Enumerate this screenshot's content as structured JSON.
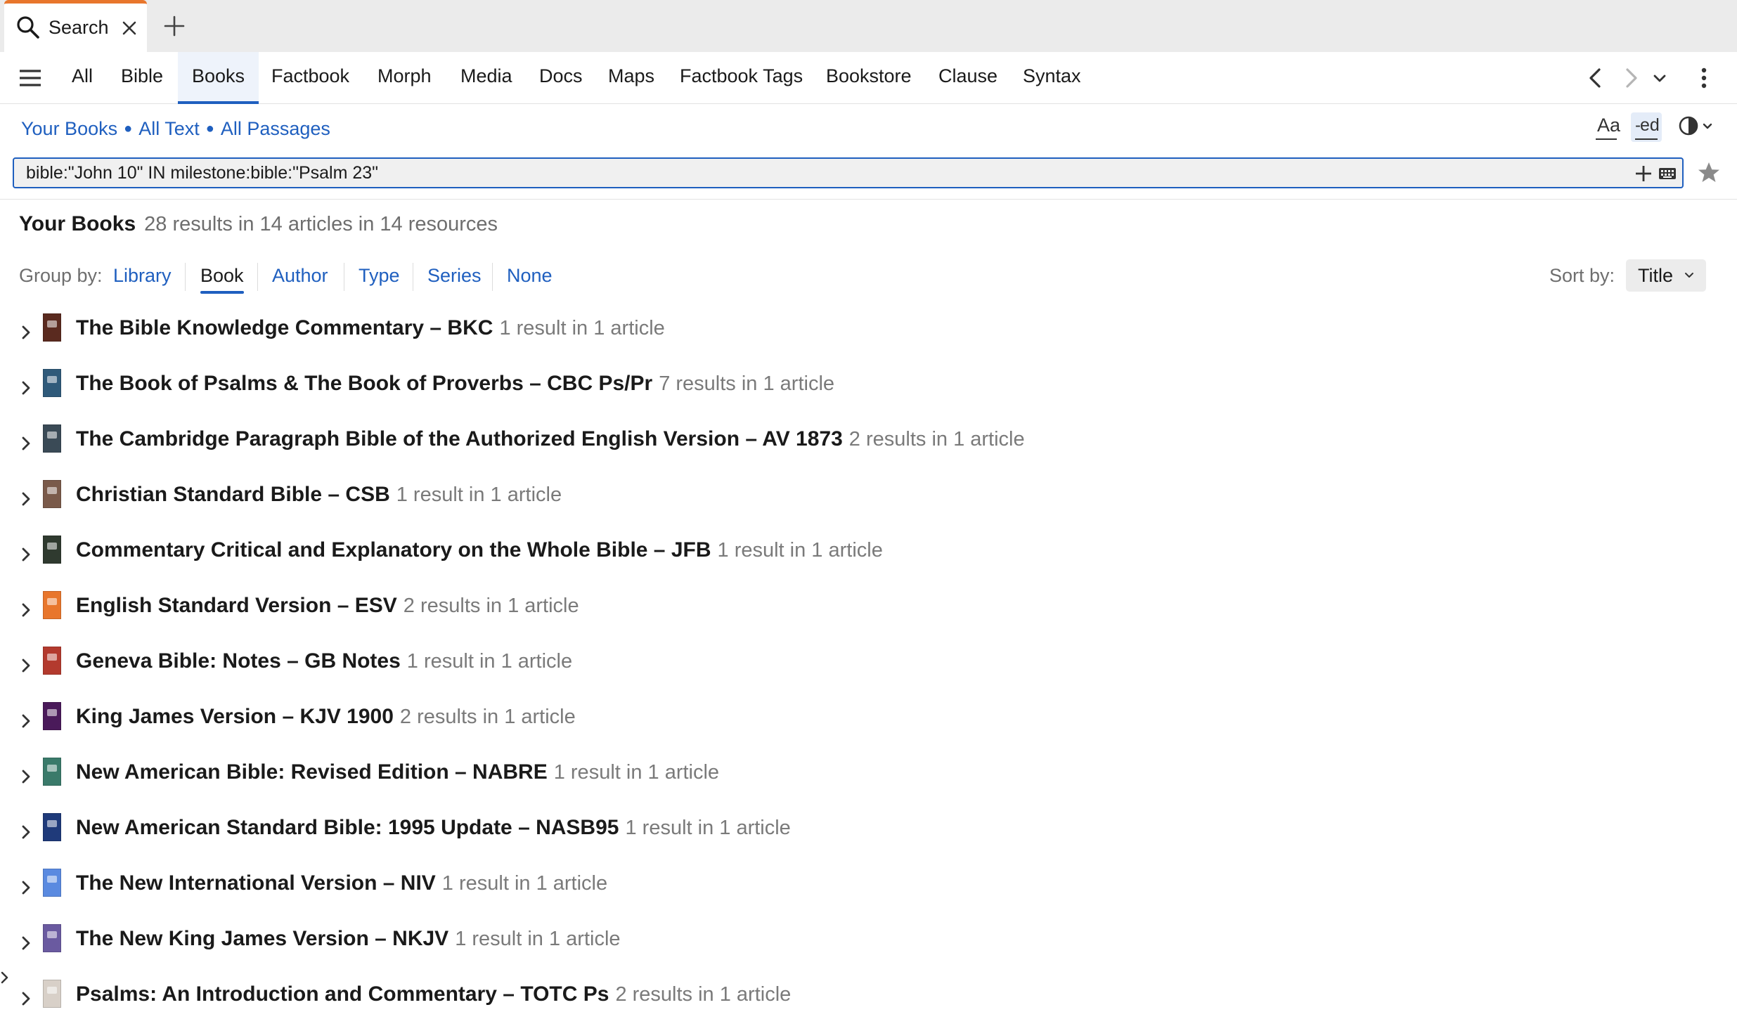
{
  "tab": {
    "title": "Search",
    "icon": "search-icon"
  },
  "nav": {
    "items": [
      "All",
      "Bible",
      "Books",
      "Factbook",
      "Morph",
      "Media",
      "Docs",
      "Maps",
      "Factbook Tags",
      "Bookstore",
      "Clause",
      "Syntax"
    ],
    "active": "Books"
  },
  "scope": {
    "books": "Your Books",
    "text": "All Text",
    "passages": "All Passages"
  },
  "toolbar": {
    "font_label": "Aa",
    "edit_label": "ed"
  },
  "query": {
    "value": "bible:\"John 10\" IN milestone:bible:\"Psalm 23\""
  },
  "summary": {
    "title": "Your Books",
    "count": "28 results in 14 articles in 14 resources"
  },
  "group_by": {
    "label": "Group by:",
    "options": [
      "Library",
      "Book",
      "Author",
      "Type",
      "Series",
      "None"
    ],
    "active": "Book"
  },
  "sort_by": {
    "label": "Sort by:",
    "value": "Title"
  },
  "results": [
    {
      "title": "The Bible Knowledge Commentary – BKC",
      "count": "1 result in 1 article",
      "cover_color": "#5a2a1f"
    },
    {
      "title": "The Book of Psalms & The Book of Proverbs – CBC Ps/Pr",
      "count": "7 results in 1 article",
      "cover_color": "#2f5a7a"
    },
    {
      "title": "The Cambridge Paragraph Bible of the Authorized English Version – AV 1873",
      "count": "2 results in 1 article",
      "cover_color": "#3a4a56"
    },
    {
      "title": "Christian Standard Bible – CSB",
      "count": "1 result in 1 article",
      "cover_color": "#7a5a4a"
    },
    {
      "title": "Commentary Critical and Explanatory on the Whole Bible – JFB",
      "count": "1 result in 1 article",
      "cover_color": "#2f3a2f"
    },
    {
      "title": "English Standard Version – ESV",
      "count": "2 results in 1 article",
      "cover_color": "#e8762c"
    },
    {
      "title": "Geneva Bible: Notes – GB Notes",
      "count": "1 result in 1 article",
      "cover_color": "#b33a2e"
    },
    {
      "title": "King James Version – KJV 1900",
      "count": "2 results in 1 article",
      "cover_color": "#4a1a5a"
    },
    {
      "title": "New American Bible: Revised Edition – NABRE",
      "count": "1 result in 1 article",
      "cover_color": "#3a7a6a"
    },
    {
      "title": "New American Standard Bible: 1995 Update – NASB95",
      "count": "1 result in 1 article",
      "cover_color": "#1f3a7a"
    },
    {
      "title": "The New International Version – NIV",
      "count": "1 result in 1 article",
      "cover_color": "#5a8ae0"
    },
    {
      "title": "The New King James Version – NKJV",
      "count": "1 result in 1 article",
      "cover_color": "#6a5aa0"
    },
    {
      "title": "Psalms: An Introduction and Commentary – TOTC Ps",
      "count": "2 results in 1 article",
      "cover_color": "#d8d0c8"
    }
  ]
}
